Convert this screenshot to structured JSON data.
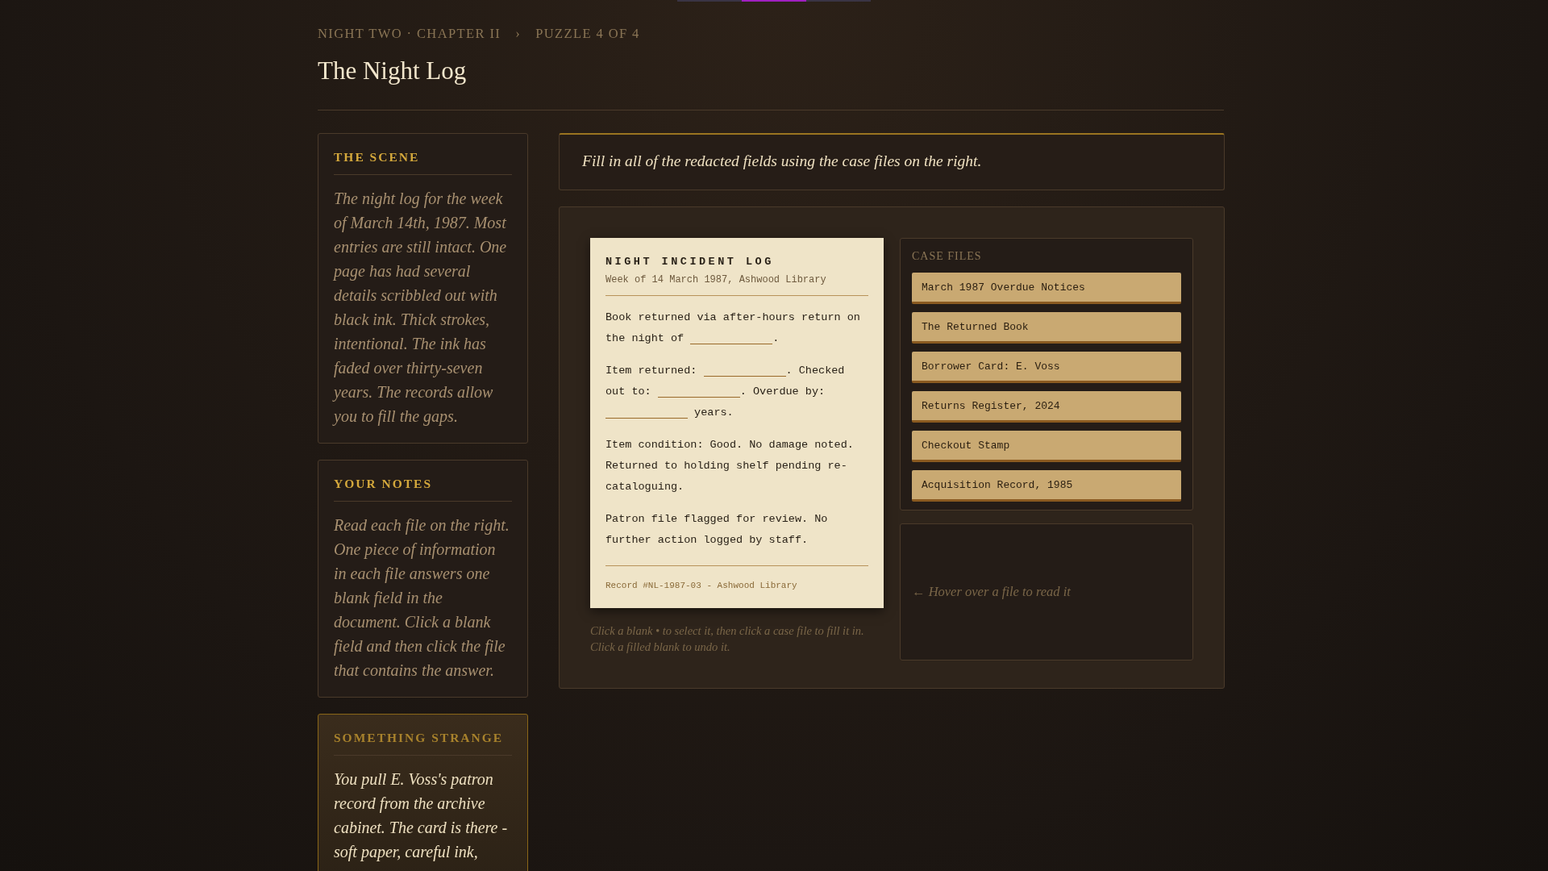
{
  "breadcrumb": {
    "chapter": "NIGHT TWO · CHAPTER II",
    "separator": "›",
    "puzzle": "PUZZLE 4 OF 4"
  },
  "title": "The Night Log",
  "sidebar": [
    {
      "kind": "normal",
      "heading": "THE SCENE",
      "text": "The night log for the week of March 14th, 1987. Most entries are still intact. One page has had several details scribbled out with black ink. Thick strokes, intentional. The ink has faded over thirty-seven years. The records allow you to fill the gaps."
    },
    {
      "kind": "normal",
      "heading": "YOUR NOTES",
      "text": "Read each file on the right. One piece of information in each file answers one blank field in the document. Click a blank field and then click the file that contains the answer."
    },
    {
      "kind": "highlight",
      "heading": "SOMETHING STRANGE",
      "text": "You pull E. Voss's patron record from the archive cabinet. The card is there - soft paper, careful ink,"
    }
  ],
  "instruction": "Fill in all of the redacted fields using the case files on the right.",
  "document": {
    "title": "NIGHT INCIDENT LOG",
    "subtitle": "Week of 14 March 1987, Ashwood Library",
    "paragraphs": [
      [
        {
          "kind": "text",
          "text": "Book returned via after-hours return on the night of "
        },
        {
          "kind": "blank"
        },
        {
          "kind": "text",
          "text": "."
        }
      ],
      [
        {
          "kind": "text",
          "text": "Item returned: "
        },
        {
          "kind": "blank"
        },
        {
          "kind": "text",
          "text": ". Checked out to: "
        },
        {
          "kind": "blank"
        },
        {
          "kind": "text",
          "text": ". Overdue by: "
        },
        {
          "kind": "blank"
        },
        {
          "kind": "text",
          "text": " years."
        }
      ],
      [
        {
          "kind": "text",
          "text": "Item condition: Good. No damage noted. Returned to holding shelf pending re-cataloguing."
        }
      ],
      [
        {
          "kind": "text",
          "text": "Patron file flagged for review. No further action logged by staff."
        }
      ]
    ],
    "footer": "Record #NL-1987-03 - Ashwood Library"
  },
  "hint": "Click a blank • to select it, then click a case file to fill it in. Click a filled blank to undo it.",
  "case_files": {
    "heading": "CASE FILES",
    "files": [
      {
        "label": "March 1987 Overdue Notices"
      },
      {
        "label": "The Returned Book"
      },
      {
        "label": "Borrower Card: E. Voss"
      },
      {
        "label": "Returns Register, 2024"
      },
      {
        "label": "Checkout Stamp"
      },
      {
        "label": "Acquisition Record, 1985"
      }
    ]
  },
  "reader": {
    "message": "← Hover over a file to read it"
  }
}
